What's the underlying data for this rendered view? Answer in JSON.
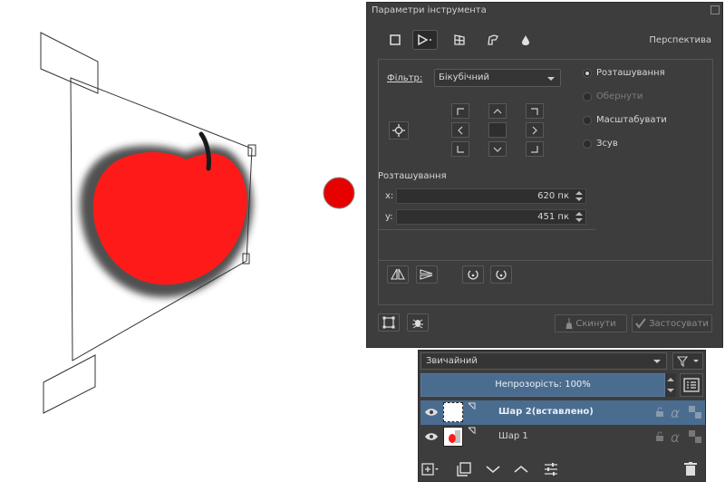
{
  "tool_options": {
    "title": "Параметри інструмента",
    "mode_label": "Перспектива",
    "filter_label": "Фільтр:",
    "filter_value": "Бікубічний",
    "radio_options": [
      {
        "label": "Розташування",
        "checked": true,
        "enabled": true
      },
      {
        "label": "Обернути",
        "checked": false,
        "enabled": false
      },
      {
        "label": "Масштабувати",
        "checked": false,
        "enabled": true
      },
      {
        "label": "Зсув",
        "checked": false,
        "enabled": true
      }
    ],
    "position_title": "Розташування",
    "x_label": "x:",
    "x_value": "620 пк",
    "y_label": "y:",
    "y_value": "451 пк",
    "reset_label": "Скинути",
    "apply_label": "Застосувати"
  },
  "layers": {
    "blend_mode": "Звичайний",
    "opacity_label": "Непрозорість:  100%",
    "items": [
      {
        "name": "Шар 2(вставлено)",
        "selected": true
      },
      {
        "name": "Шар 1",
        "selected": false
      }
    ]
  },
  "colors": {
    "panel_bg": "#3d3d3d",
    "selection": "#4a6c8f",
    "apple_red": "#ff1a1a",
    "dot_red": "#e60000"
  }
}
